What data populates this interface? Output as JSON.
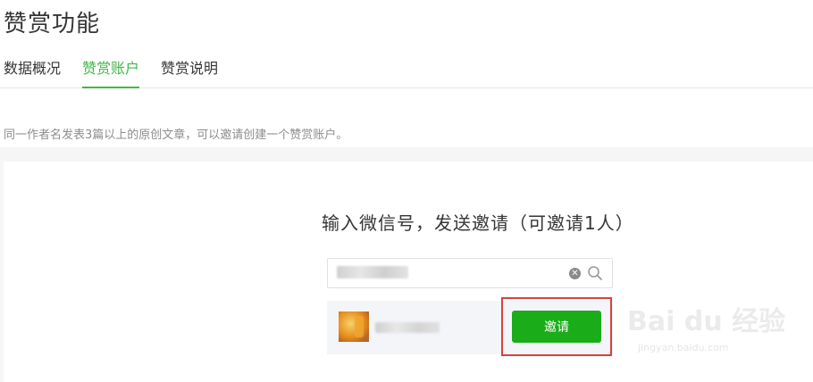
{
  "page": {
    "title": "赞赏功能"
  },
  "tabs": [
    {
      "label": "数据概况",
      "active": false
    },
    {
      "label": "赞赏账户",
      "active": true
    },
    {
      "label": "赞赏说明",
      "active": false
    }
  ],
  "notice": "同一作者名发表3篇以上的原创文章，可以邀请创建一个赞赏账户。",
  "invite": {
    "heading": "输入微信号，发送邀请（可邀请1人）",
    "button_label": "邀请",
    "search_icon": "search-icon",
    "clear_icon": "clear-icon"
  },
  "watermark": {
    "brand": "Bai du 经验",
    "url": "jingyan.baidu.com"
  },
  "colors": {
    "accent": "#44b549",
    "button": "#1aad19",
    "highlight": "#d93f3f"
  }
}
